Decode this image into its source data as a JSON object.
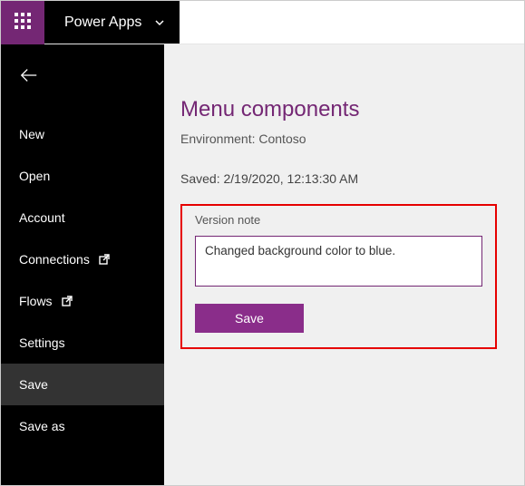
{
  "header": {
    "app_name": "Power Apps"
  },
  "sidebar": {
    "items": [
      {
        "label": "New"
      },
      {
        "label": "Open"
      },
      {
        "label": "Account"
      },
      {
        "label": "Connections",
        "external": true
      },
      {
        "label": "Flows",
        "external": true
      },
      {
        "label": "Settings"
      },
      {
        "label": "Save"
      },
      {
        "label": "Save as"
      }
    ]
  },
  "main": {
    "title": "Menu components",
    "environment_prefix": "Environment: ",
    "environment_name": "Contoso",
    "saved_prefix": "Saved: ",
    "saved_timestamp": "2/19/2020, 12:13:30 AM",
    "version_note_label": "Version note",
    "version_note_value": "Changed background color to blue.",
    "save_button_label": "Save"
  },
  "colors": {
    "brand": "#742774",
    "highlight": "#e60000"
  }
}
